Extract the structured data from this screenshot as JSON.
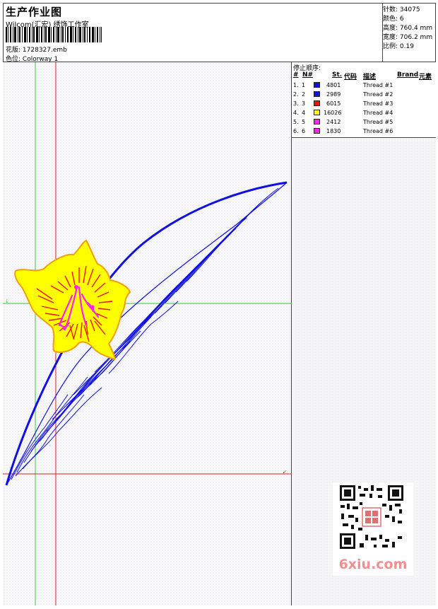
{
  "header": {
    "title": "生产作业图",
    "company": "Wilcom(汇宏) 绣饰工作室",
    "design_label": "花版:",
    "design_value": "1728327.emb",
    "colorway_label": "色位:",
    "colorway_value": "Colorway 1"
  },
  "stats": [
    {
      "label": "针数:",
      "value": "34075"
    },
    {
      "label": "颜色:",
      "value": "6"
    },
    {
      "label": "高度:",
      "value": "760.4 mm"
    },
    {
      "label": "宽度:",
      "value": "706.2 mm"
    },
    {
      "label": "比例:",
      "value": "0.19"
    }
  ],
  "stop_sequence": {
    "title": "停止顺序:",
    "headers": {
      "num": "#",
      "n": "N#",
      "st": "St.",
      "code": "代码",
      "desc": "描述",
      "brand": "Brand",
      "element": "元素"
    },
    "rows": [
      {
        "num": "1.",
        "n": "1",
        "color": "#1010e0",
        "code": "4801",
        "desc": "Thread #1"
      },
      {
        "num": "2.",
        "n": "2",
        "color": "#1010e0",
        "code": "2989",
        "desc": "Thread #2"
      },
      {
        "num": "3.",
        "n": "3",
        "color": "#ee1111",
        "code": "6015",
        "desc": "Thread #3"
      },
      {
        "num": "4.",
        "n": "4",
        "color": "#ffff00",
        "code": "16026",
        "desc": "Thread #4"
      },
      {
        "num": "5.",
        "n": "5",
        "color": "#ff22ee",
        "code": "2412",
        "desc": "Thread #5"
      },
      {
        "num": "6.",
        "n": "6",
        "color": "#ff22ee",
        "code": "1830",
        "desc": "Thread #6"
      }
    ]
  },
  "colors": {
    "blue": "#1010e0",
    "red": "#ee1111",
    "yellow": "#ffff00",
    "magenta": "#ff22ee",
    "green_guide": "#33cc33",
    "red_guide": "#dd2222"
  },
  "watermark": {
    "text": "6xiu.com"
  }
}
